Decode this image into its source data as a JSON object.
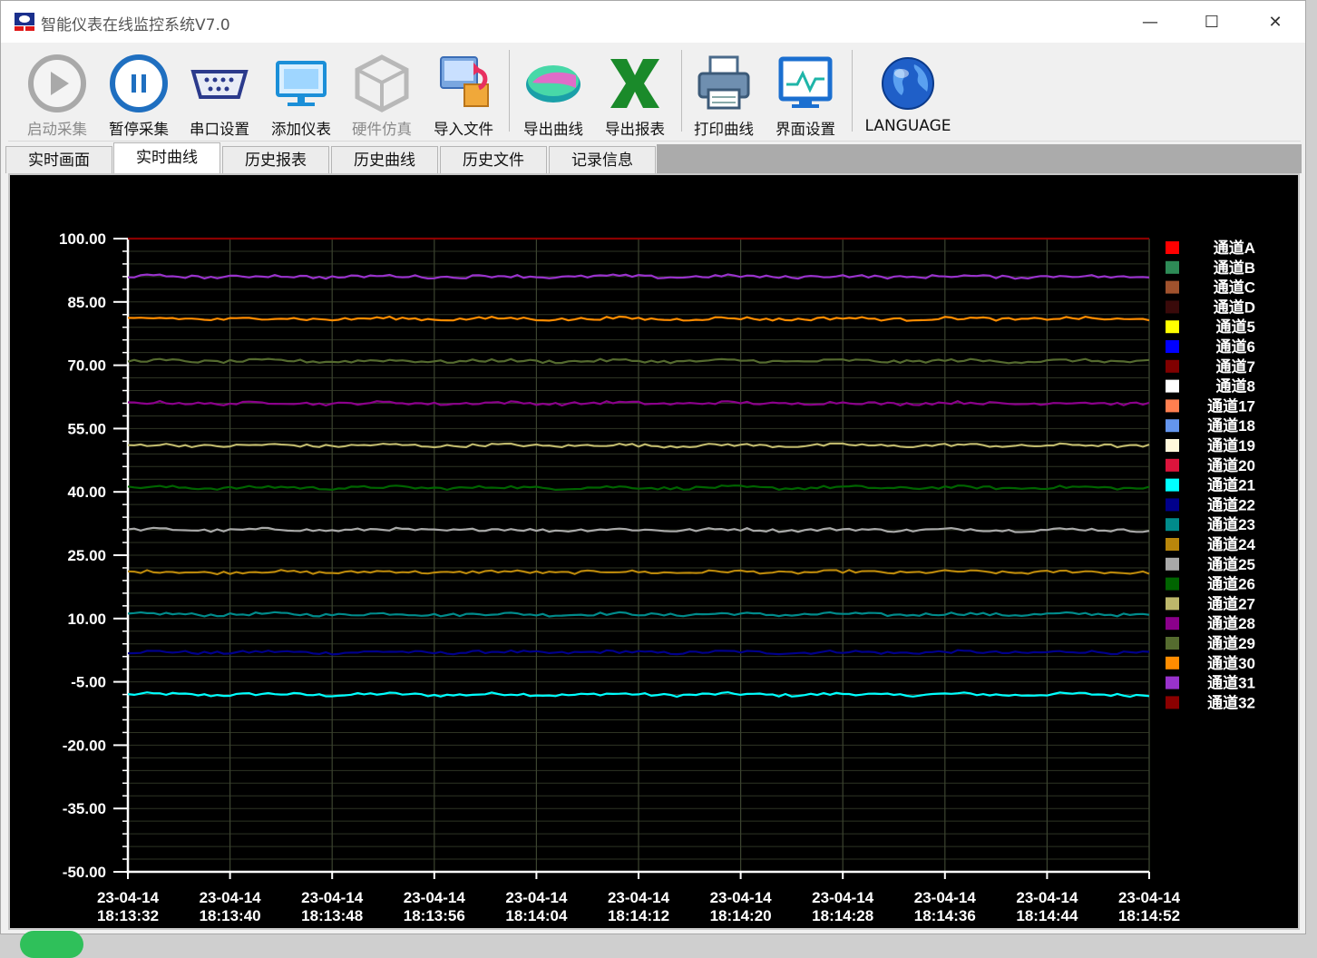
{
  "window": {
    "title": "智能仪表在线监控系统V7.0",
    "controls": {
      "minimize": "—",
      "maximize": "☐",
      "close": "✕"
    }
  },
  "toolbar": {
    "buttons": [
      {
        "label": "启动采集",
        "icon": "play-icon",
        "enabled": false
      },
      {
        "label": "暂停采集",
        "icon": "pause-icon",
        "enabled": true
      },
      {
        "label": "串口设置",
        "icon": "serial-port-icon",
        "enabled": true
      },
      {
        "label": "添加仪表",
        "icon": "monitor-icon",
        "enabled": true
      },
      {
        "label": "硬件仿真",
        "icon": "cube-icon",
        "enabled": false
      },
      {
        "label": "导入文件",
        "icon": "import-file-icon",
        "enabled": true
      },
      {
        "label": "导出曲线",
        "icon": "export-curve-icon",
        "enabled": true
      },
      {
        "label": "导出报表",
        "icon": "excel-icon",
        "enabled": true
      },
      {
        "label": "打印曲线",
        "icon": "printer-icon",
        "enabled": true
      },
      {
        "label": "界面设置",
        "icon": "screen-settings-icon",
        "enabled": true
      },
      {
        "label": "LANGUAGE",
        "icon": "globe-icon",
        "enabled": true
      }
    ]
  },
  "tabs": [
    {
      "label": "实时画面",
      "active": false
    },
    {
      "label": "实时曲线",
      "active": true
    },
    {
      "label": "历史报表",
      "active": false
    },
    {
      "label": "历史曲线",
      "active": false
    },
    {
      "label": "历史文件",
      "active": false
    },
    {
      "label": "记录信息",
      "active": false
    }
  ],
  "chart_data": {
    "type": "line",
    "ylim": [
      -50,
      100
    ],
    "y_ticks": [
      "100.00",
      "85.00",
      "70.00",
      "55.00",
      "40.00",
      "25.00",
      "10.00",
      "-5.00",
      "-20.00",
      "-35.00",
      "-50.00"
    ],
    "x_ticks": [
      {
        "date": "23-04-14",
        "time": "18:13:32"
      },
      {
        "date": "23-04-14",
        "time": "18:13:40"
      },
      {
        "date": "23-04-14",
        "time": "18:13:48"
      },
      {
        "date": "23-04-14",
        "time": "18:13:56"
      },
      {
        "date": "23-04-14",
        "time": "18:14:04"
      },
      {
        "date": "23-04-14",
        "time": "18:14:12"
      },
      {
        "date": "23-04-14",
        "time": "18:14:20"
      },
      {
        "date": "23-04-14",
        "time": "18:14:28"
      },
      {
        "date": "23-04-14",
        "time": "18:14:36"
      },
      {
        "date": "23-04-14",
        "time": "18:14:44"
      },
      {
        "date": "23-04-14",
        "time": "18:14:52"
      }
    ],
    "grid": true,
    "legend_position": "right",
    "background": "#000000",
    "series": [
      {
        "name": "通道A",
        "color": "#ff0000"
      },
      {
        "name": "通道B",
        "color": "#2e8b57"
      },
      {
        "name": "通道C",
        "color": "#a0522d"
      },
      {
        "name": "通道D",
        "color": "#3a0a0a"
      },
      {
        "name": "通道5",
        "color": "#ffff00"
      },
      {
        "name": "通道6",
        "color": "#0000ff"
      },
      {
        "name": "通道7",
        "color": "#800000"
      },
      {
        "name": "通道8",
        "color": "#ffffff"
      },
      {
        "name": "通道17",
        "color": "#ff7f50"
      },
      {
        "name": "通道18",
        "color": "#6495ed"
      },
      {
        "name": "通道19",
        "color": "#fff8dc"
      },
      {
        "name": "通道20",
        "color": "#dc143c"
      },
      {
        "name": "通道21",
        "color": "#00ffff",
        "value": -8
      },
      {
        "name": "通道22",
        "color": "#00008b",
        "value": 2
      },
      {
        "name": "通道23",
        "color": "#008b8b",
        "value": 11
      },
      {
        "name": "通道24",
        "color": "#b8860b",
        "value": 21
      },
      {
        "name": "通道25",
        "color": "#a9a9a9",
        "value": 31
      },
      {
        "name": "通道26",
        "color": "#006400",
        "value": 41
      },
      {
        "name": "通道27",
        "color": "#bdb76b",
        "value": 51
      },
      {
        "name": "通道28",
        "color": "#8b008b",
        "value": 61
      },
      {
        "name": "通道29",
        "color": "#556b2f",
        "value": 71
      },
      {
        "name": "通道30",
        "color": "#ff8c00",
        "value": 81
      },
      {
        "name": "通道31",
        "color": "#9932cc",
        "value": 91
      },
      {
        "name": "通道32",
        "color": "#8b0000",
        "value": 100
      }
    ]
  }
}
